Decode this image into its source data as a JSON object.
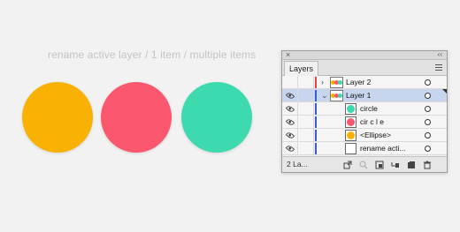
{
  "caption": "rename active layer / 1 item / multiple items",
  "circles": [
    {
      "name": "orange-circle",
      "color": "#f9b104"
    },
    {
      "name": "pink-circle",
      "color": "#fb5870"
    },
    {
      "name": "teal-circle",
      "color": "#3ddab0"
    }
  ],
  "panel": {
    "title_close": "×",
    "title_collapse": "‹‹",
    "tab_label": "Layers",
    "footer_count": "2 La...",
    "rows": [
      {
        "label": "Layer 2",
        "twisty": "›",
        "bar_color": "#e8473f"
      },
      {
        "label": "Layer 1",
        "twisty": "⌄",
        "bar_color": "#3a5bd9"
      },
      {
        "label": "circle",
        "swatch_color": "#3ddab0",
        "bar_color": "#3a5bd9"
      },
      {
        "label": "cir c l e",
        "swatch_color": "#fb5870",
        "bar_color": "#3a5bd9"
      },
      {
        "label": "<Ellipse>",
        "swatch_color": "#f9b104",
        "bar_color": "#3a5bd9"
      },
      {
        "label": "rename acti...",
        "bar_color": "#3a5bd9"
      }
    ]
  },
  "selection_color": "#c7d6ee"
}
